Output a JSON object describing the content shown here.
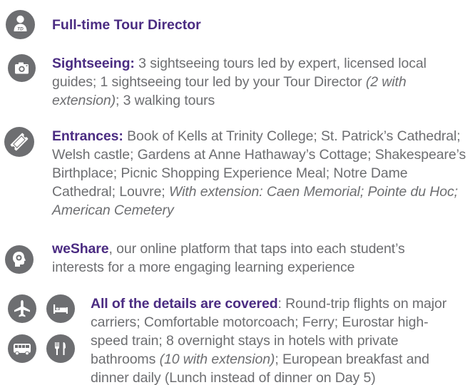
{
  "colors": {
    "accent": "#4b2c82",
    "text": "#6d6e71",
    "icon_bg": "#6d6e71"
  },
  "items": [
    {
      "icon": "tour-director-icon",
      "title": "Full-time Tour Director"
    },
    {
      "icon": "camera-icon",
      "title": "Sightseeing:",
      "text1": " 3 sightseeing tours led by expert, licensed local guides; 1 sightseeing tour led by your Tour Director ",
      "italic1": "(2 with extension)",
      "text2": "; 3 walking tours"
    },
    {
      "icon": "ticket-icon",
      "title": "Entrances:",
      "text1": " Book of Kells at Trinity College; St. Patrick’s Cathedral; Welsh castle; Gardens at Anne Hathaway’s Cottage; Shakespeare’s Birthplace; Picnic Shopping Experience Meal; Notre Dame Cathedral; Louvre; ",
      "italic1": "With extension: Caen Memorial; Pointe du Hoc; American Cemetery"
    },
    {
      "icon": "head-icon",
      "title": "weShare",
      "text1": ", our online platform that taps into each student’s interests for a more engaging learning experience"
    },
    {
      "icons": [
        "airplane-icon",
        "bed-icon",
        "bus-icon",
        "utensils-icon"
      ],
      "title": "All of the details are covered",
      "text1": ": Round-trip flights on major carriers; Comfortable motorcoach; Ferry; Eurostar high-speed train; 8 overnight stays in hotels with private bathrooms ",
      "italic1": "(10 with extension)",
      "text2": "; European breakfast and dinner daily (Lunch instead of dinner on Day 5)"
    }
  ]
}
